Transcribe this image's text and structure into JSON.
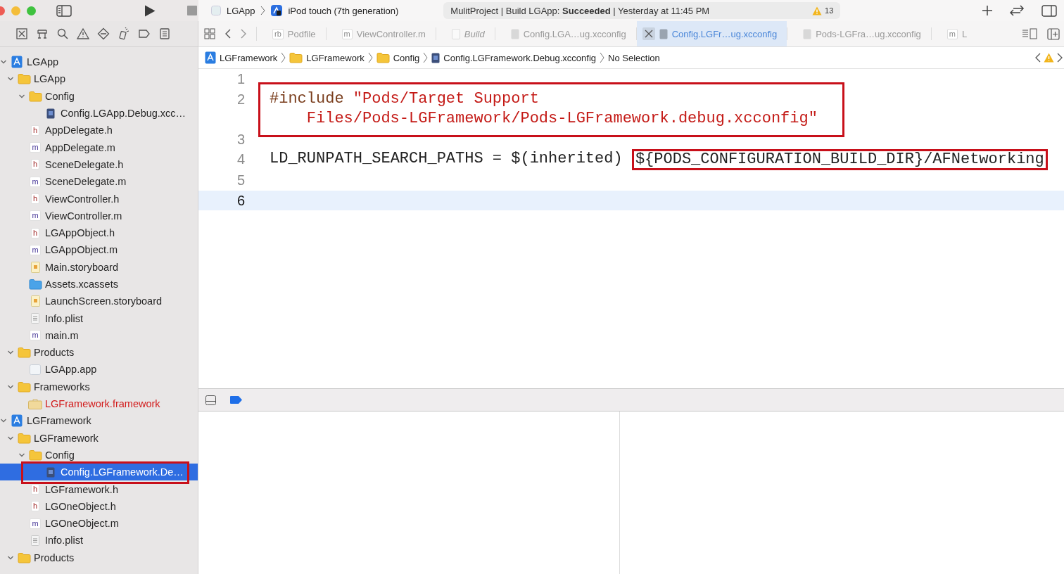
{
  "toolbar": {
    "scheme": "LGApp",
    "device": "iPod touch (7th generation)",
    "status": "MulitProject | Build LGApp: **Succeeded** | Yesterday at 11:45 PM",
    "warning_count": "13"
  },
  "sidebar": {
    "items": [
      {
        "kind": "project",
        "name": "LGApp",
        "expanded": true,
        "selected": false,
        "missing": false,
        "annotated": false,
        "children": [
          {
            "kind": "folder",
            "name": "LGApp",
            "expanded": true,
            "selected": false,
            "missing": false,
            "annotated": false,
            "children": [
              {
                "kind": "folder",
                "name": "Config",
                "expanded": true,
                "selected": false,
                "missing": false,
                "annotated": false,
                "children": [
                  {
                    "kind": "xcconfig",
                    "name": "Config.LGApp.Debug.xcc…",
                    "selected": false,
                    "missing": false,
                    "annotated": false
                  }
                ]
              },
              {
                "kind": "header",
                "badge": "h",
                "name": "AppDelegate.h",
                "selected": false,
                "missing": false,
                "annotated": false
              },
              {
                "kind": "implementation",
                "badge": "m",
                "name": "AppDelegate.m",
                "selected": false,
                "missing": false,
                "annotated": false
              },
              {
                "kind": "header",
                "badge": "h",
                "name": "SceneDelegate.h",
                "selected": false,
                "missing": false,
                "annotated": false
              },
              {
                "kind": "implementation",
                "badge": "m",
                "name": "SceneDelegate.m",
                "selected": false,
                "missing": false,
                "annotated": false
              },
              {
                "kind": "header",
                "badge": "h",
                "name": "ViewController.h",
                "selected": false,
                "missing": false,
                "annotated": false
              },
              {
                "kind": "implementation",
                "badge": "m",
                "name": "ViewController.m",
                "selected": false,
                "missing": false,
                "annotated": false
              },
              {
                "kind": "header",
                "badge": "h",
                "name": "LGAppObject.h",
                "selected": false,
                "missing": false,
                "annotated": false
              },
              {
                "kind": "implementation",
                "badge": "m",
                "name": "LGAppObject.m",
                "selected": false,
                "missing": false,
                "annotated": false
              },
              {
                "kind": "storyboard",
                "name": "Main.storyboard",
                "selected": false,
                "missing": false,
                "annotated": false
              },
              {
                "kind": "assets",
                "name": "Assets.xcassets",
                "selected": false,
                "missing": false,
                "annotated": false
              },
              {
                "kind": "storyboard",
                "name": "LaunchScreen.storyboard",
                "selected": false,
                "missing": false,
                "annotated": false
              },
              {
                "kind": "plist",
                "name": "Info.plist",
                "selected": false,
                "missing": false,
                "annotated": false
              },
              {
                "kind": "implementation",
                "badge": "m",
                "name": "main.m",
                "selected": false,
                "missing": false,
                "annotated": false
              }
            ]
          },
          {
            "kind": "folder",
            "name": "Products",
            "expanded": true,
            "selected": false,
            "missing": false,
            "annotated": false,
            "children": [
              {
                "kind": "app",
                "name": "LGApp.app",
                "selected": false,
                "missing": false,
                "annotated": false
              }
            ]
          },
          {
            "kind": "folder",
            "name": "Frameworks",
            "expanded": true,
            "selected": false,
            "missing": false,
            "annotated": false,
            "children": [
              {
                "kind": "framework",
                "name": "LGFramework.framework",
                "selected": false,
                "missing": true,
                "annotated": false
              }
            ]
          }
        ]
      },
      {
        "kind": "project",
        "name": "LGFramework",
        "expanded": true,
        "selected": false,
        "missing": false,
        "annotated": false,
        "children": [
          {
            "kind": "folder",
            "name": "LGFramework",
            "expanded": true,
            "selected": false,
            "missing": false,
            "annotated": false,
            "children": [
              {
                "kind": "folder",
                "name": "Config",
                "expanded": true,
                "selected": false,
                "missing": false,
                "annotated": false,
                "children": [
                  {
                    "kind": "xcconfig",
                    "name": "Config.LGFramework.De…",
                    "selected": true,
                    "missing": false,
                    "annotated": true
                  }
                ]
              },
              {
                "kind": "header",
                "badge": "h",
                "name": "LGFramework.h",
                "selected": false,
                "missing": false,
                "annotated": false
              },
              {
                "kind": "header",
                "badge": "h",
                "name": "LGOneObject.h",
                "selected": false,
                "missing": false,
                "annotated": false
              },
              {
                "kind": "implementation",
                "badge": "m",
                "name": "LGOneObject.m",
                "selected": false,
                "missing": false,
                "annotated": false
              },
              {
                "kind": "plist",
                "name": "Info.plist",
                "selected": false,
                "missing": false,
                "annotated": false
              }
            ]
          },
          {
            "kind": "folder",
            "name": "Products",
            "expanded": true,
            "selected": false,
            "missing": false,
            "annotated": false
          }
        ]
      }
    ]
  },
  "editor": {
    "tabs": [
      {
        "kind": "letter",
        "badge": "rb",
        "label": "Podfile",
        "selected": false
      },
      {
        "kind": "letter",
        "badge": "m",
        "label": "ViewController.m",
        "selected": false
      },
      {
        "kind": "build",
        "label": "Build",
        "selected": false
      },
      {
        "kind": "config",
        "label": "Config.LGA…ug.xcconfig",
        "selected": false
      },
      {
        "kind": "config",
        "label": "Config.LGFr…ug.xcconfig",
        "selected": true
      },
      {
        "kind": "config",
        "label": "Pods-LGFra…ug.xcconfig",
        "selected": false
      },
      {
        "kind": "letter",
        "badge": "m",
        "label": "L",
        "selected": false
      }
    ],
    "breadcrumb": [
      {
        "kind": "project",
        "label": "LGFramework"
      },
      {
        "kind": "folder",
        "label": "LGFramework"
      },
      {
        "kind": "folder",
        "label": "Config"
      },
      {
        "kind": "xcconfig",
        "label": "Config.LGFramework.Debug.xcconfig"
      },
      {
        "kind": "plain",
        "label": "No Selection"
      }
    ],
    "lines": [
      {
        "number": "1",
        "kind": "blank",
        "selected": false
      },
      {
        "number": "2",
        "kind": "include",
        "keyword": "#include",
        "string_lines": [
          "\"Pods/Target Support",
          "Files/Pods-LGFramework/Pods-LGFramework.debug.xcconfig\""
        ],
        "selected": false,
        "annotated": true
      },
      {
        "number": "3",
        "kind": "blank",
        "selected": false
      },
      {
        "number": "4",
        "kind": "setting",
        "text": "LD_RUNPATH_SEARCH_PATHS = $(inherited)",
        "annotated_text": "${PODS_CONFIGURATION_BUILD_DIR}/AFNetworking",
        "selected": false,
        "annotated": true
      },
      {
        "number": "5",
        "kind": "blank",
        "selected": false
      },
      {
        "number": "6",
        "kind": "blank",
        "selected": true
      }
    ]
  }
}
